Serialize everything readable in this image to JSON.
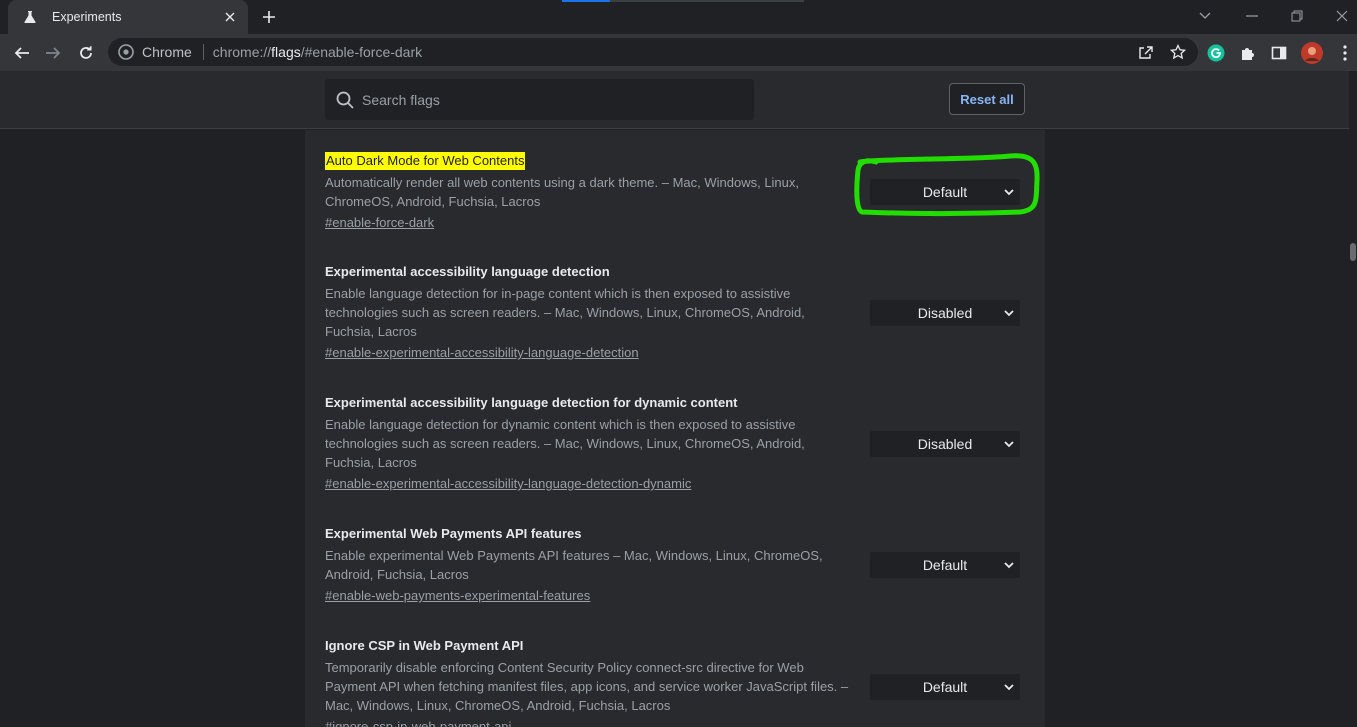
{
  "tab": {
    "title": "Experiments",
    "icon": "flask-icon"
  },
  "omnibox": {
    "site": "Chrome",
    "url_scheme": "chrome://",
    "url_host": "flags",
    "url_rest": "/#enable-force-dark"
  },
  "search": {
    "placeholder": "Search flags"
  },
  "header": {
    "reset_label": "Reset all"
  },
  "flags": [
    {
      "title": "Auto Dark Mode for Web Contents",
      "description": "Automatically render all web contents using a dark theme. – Mac, Windows, Linux, ChromeOS, Android, Fuchsia, Lacros",
      "link": "#enable-force-dark",
      "value": "Default",
      "highlighted": true
    },
    {
      "title": "Experimental accessibility language detection",
      "description": "Enable language detection for in-page content which is then exposed to assistive technologies such as screen readers. – Mac, Windows, Linux, ChromeOS, Android, Fuchsia, Lacros",
      "link": "#enable-experimental-accessibility-language-detection",
      "value": "Disabled"
    },
    {
      "title": "Experimental accessibility language detection for dynamic content",
      "description": "Enable language detection for dynamic content which is then exposed to assistive technologies such as screen readers. – Mac, Windows, Linux, ChromeOS, Android, Fuchsia, Lacros",
      "link": "#enable-experimental-accessibility-language-detection-dynamic",
      "value": "Disabled"
    },
    {
      "title": "Experimental Web Payments API features",
      "description": "Enable experimental Web Payments API features – Mac, Windows, Linux, ChromeOS, Android, Fuchsia, Lacros",
      "link": "#enable-web-payments-experimental-features",
      "value": "Default"
    },
    {
      "title": "Ignore CSP in Web Payment API",
      "description": "Temporarily disable enforcing Content Security Policy connect-src directive for Web Payment API when fetching manifest files, app icons, and service worker JavaScript files. – Mac, Windows, Linux, ChromeOS, Android, Fuchsia, Lacros",
      "link": "#ignore-csp-in-web-payment-api",
      "value": "Default"
    }
  ],
  "colors": {
    "highlight": "#ffff00",
    "annotation": "#22dd00",
    "link_accent": "#8ab4f8"
  }
}
